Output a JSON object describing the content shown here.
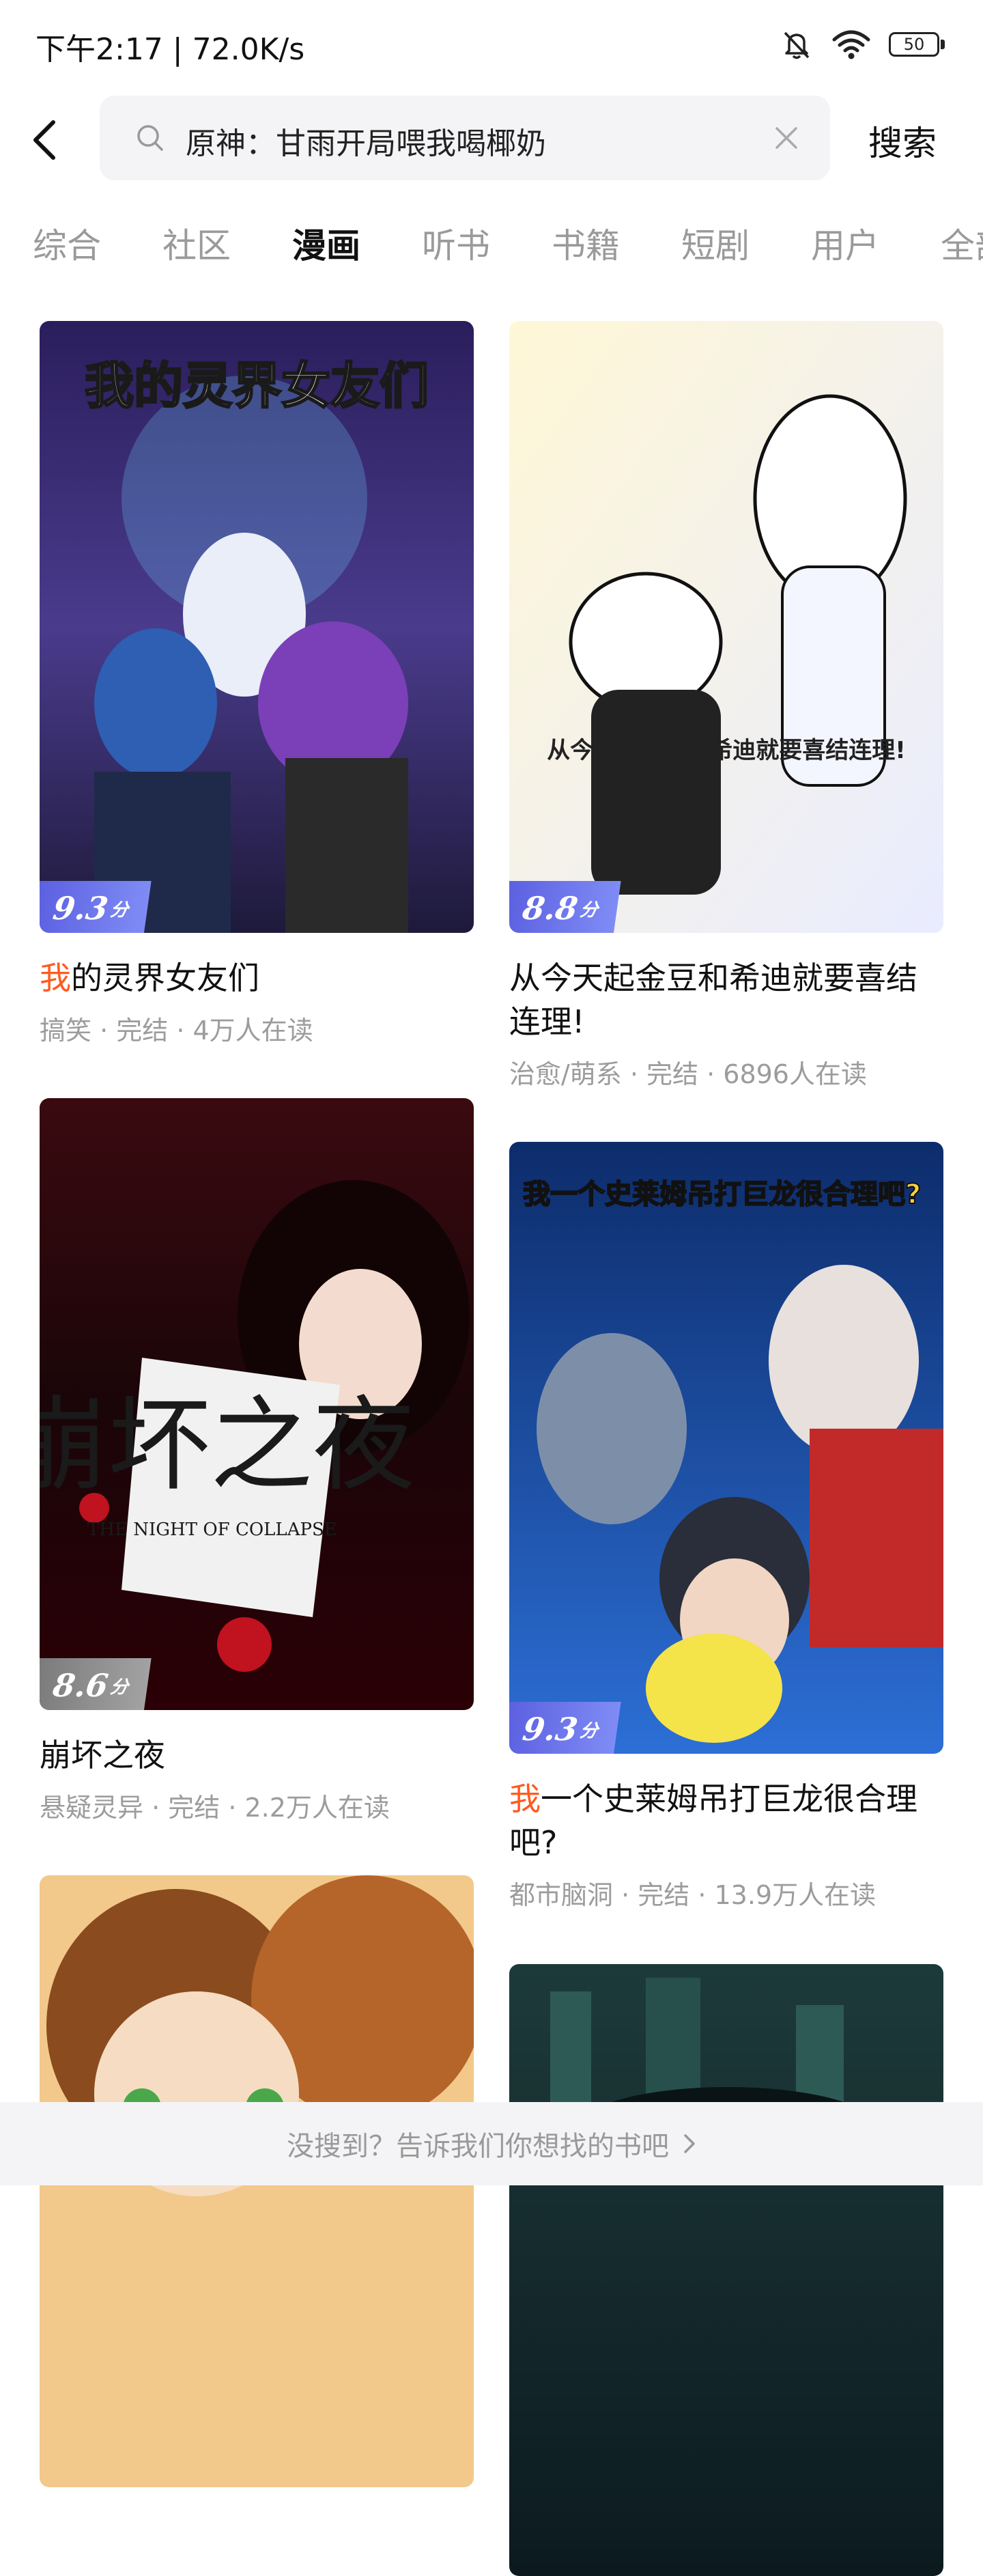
{
  "status_bar": {
    "time_speed": "下午2:17 | 72.0K/s",
    "icons": [
      "mute-icon",
      "wifi-icon",
      "battery-icon"
    ],
    "battery_level": "50"
  },
  "search": {
    "query": "原神：甘雨开局喂我喝椰奶",
    "button_label": "搜索"
  },
  "tabs": [
    {
      "label": "综合",
      "active": false
    },
    {
      "label": "社区",
      "active": false
    },
    {
      "label": "漫画",
      "active": true
    },
    {
      "label": "听书",
      "active": false
    },
    {
      "label": "书籍",
      "active": false
    },
    {
      "label": "短剧",
      "active": false
    },
    {
      "label": "用户",
      "active": false
    },
    {
      "label": "全部",
      "active": false
    }
  ],
  "results": [
    {
      "cover_text": "我的灵界女友们",
      "score": "9.3",
      "score_unit": "分",
      "title_highlight": "我",
      "title_rest": "的灵界女友们",
      "meta": "搞笑 · 完结 · 4万人在读"
    },
    {
      "cover_text": "从今天起金豆和希迪就要喜结连理!",
      "score": "8.8",
      "score_unit": "分",
      "title_highlight": "",
      "title_rest": "从今天起金豆和希迪就要喜结连理!",
      "meta": "治愈/萌系 · 完结 · 6896人在读"
    },
    {
      "cover_text": "崩坏之夜",
      "cover_subtext": "THE NIGHT OF COLLAPSE",
      "score": "8.6",
      "score_unit": "分",
      "title_highlight": "",
      "title_rest": "崩坏之夜",
      "meta": "悬疑灵异 · 完结 · 2.2万人在读"
    },
    {
      "cover_text": "我一个史莱姆吊打巨龙很合理吧?",
      "score": "9.3",
      "score_unit": "分",
      "title_highlight": "我",
      "title_rest": "一个史莱姆吊打巨龙很合理吧?",
      "meta": "都市脑洞 · 完结 · 13.9万人在读"
    }
  ],
  "colors": {
    "highlight": "#ff5a1f",
    "badge_blue": "#5b5fe0",
    "badge_gray": "#8a8a8a",
    "muted_text": "#9c9c9c"
  },
  "bottom_bar": {
    "text": "没搜到？告诉我们你想找的书吧"
  }
}
